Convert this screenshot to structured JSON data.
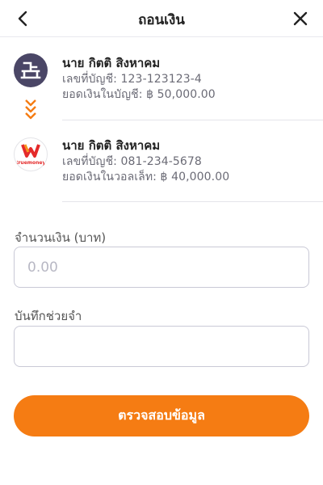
{
  "header": {
    "title": "ถอนเงิน",
    "back_icon": "chevron-left-icon",
    "close_icon": "close-icon"
  },
  "from_account": {
    "logo_icon": "bank-logo-icon",
    "name": "นาย กิตติ สิงหาคม",
    "account_line": "เลขที่บัญชี: 123-123123-4",
    "balance_line": "ยอดเงินในบัญชี: ฿ 50,000.00"
  },
  "transfer_arrow_icon": "double-chevron-down-icon",
  "to_account": {
    "logo_icon": "truemoney-logo-icon",
    "logo_text": "truemoney",
    "name": "นาย กิตติ สิงหาคม",
    "account_line": "เลขที่บัญชี: 081-234-5678",
    "balance_line": "ยอดเงินในวอลเล็ท: ฿ 40,000.00"
  },
  "form": {
    "amount_label": "จำนวนเงิน (บาท)",
    "amount_placeholder": "0.00",
    "amount_value": "",
    "memo_label": "บันทึกช่วยจำ",
    "memo_value": ""
  },
  "submit_label": "ตรวจสอบข้อมูล",
  "colors": {
    "accent": "#f57c13",
    "bank_logo_bg": "#4a4666",
    "truemoney_red": "#e42a2a",
    "truemoney_orange": "#f7941d"
  }
}
